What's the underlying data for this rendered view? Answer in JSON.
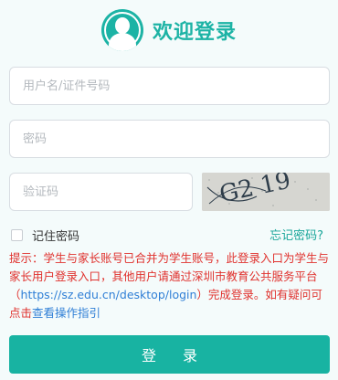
{
  "header": {
    "title": "欢迎登录",
    "icon": "user-avatar-icon"
  },
  "form": {
    "username_placeholder": "用户名/证件号码",
    "password_placeholder": "密码",
    "captcha_placeholder": "验证码",
    "captcha_text": "G2 19",
    "remember_label": "记住密码",
    "remember_checked": false,
    "forgot_label": "忘记密码?"
  },
  "notice": {
    "part1": "提示：学生与家长账号已合并为学生账号，此登录入口为学生与家长用户登录入口，其他用户请通过深圳市教育公共服务平台（",
    "platform_link": "https://sz.edu.cn/desktop/login",
    "part2": "）完成登录。如有疑问可点击",
    "guide_link": "查看操作指引"
  },
  "login_button": "登 录",
  "colors": {
    "accent": "#1cb3a5",
    "button": "#18b3a2",
    "notice": "#e0322e",
    "link": "#2f7fd6",
    "background": "#f4fbfb"
  }
}
